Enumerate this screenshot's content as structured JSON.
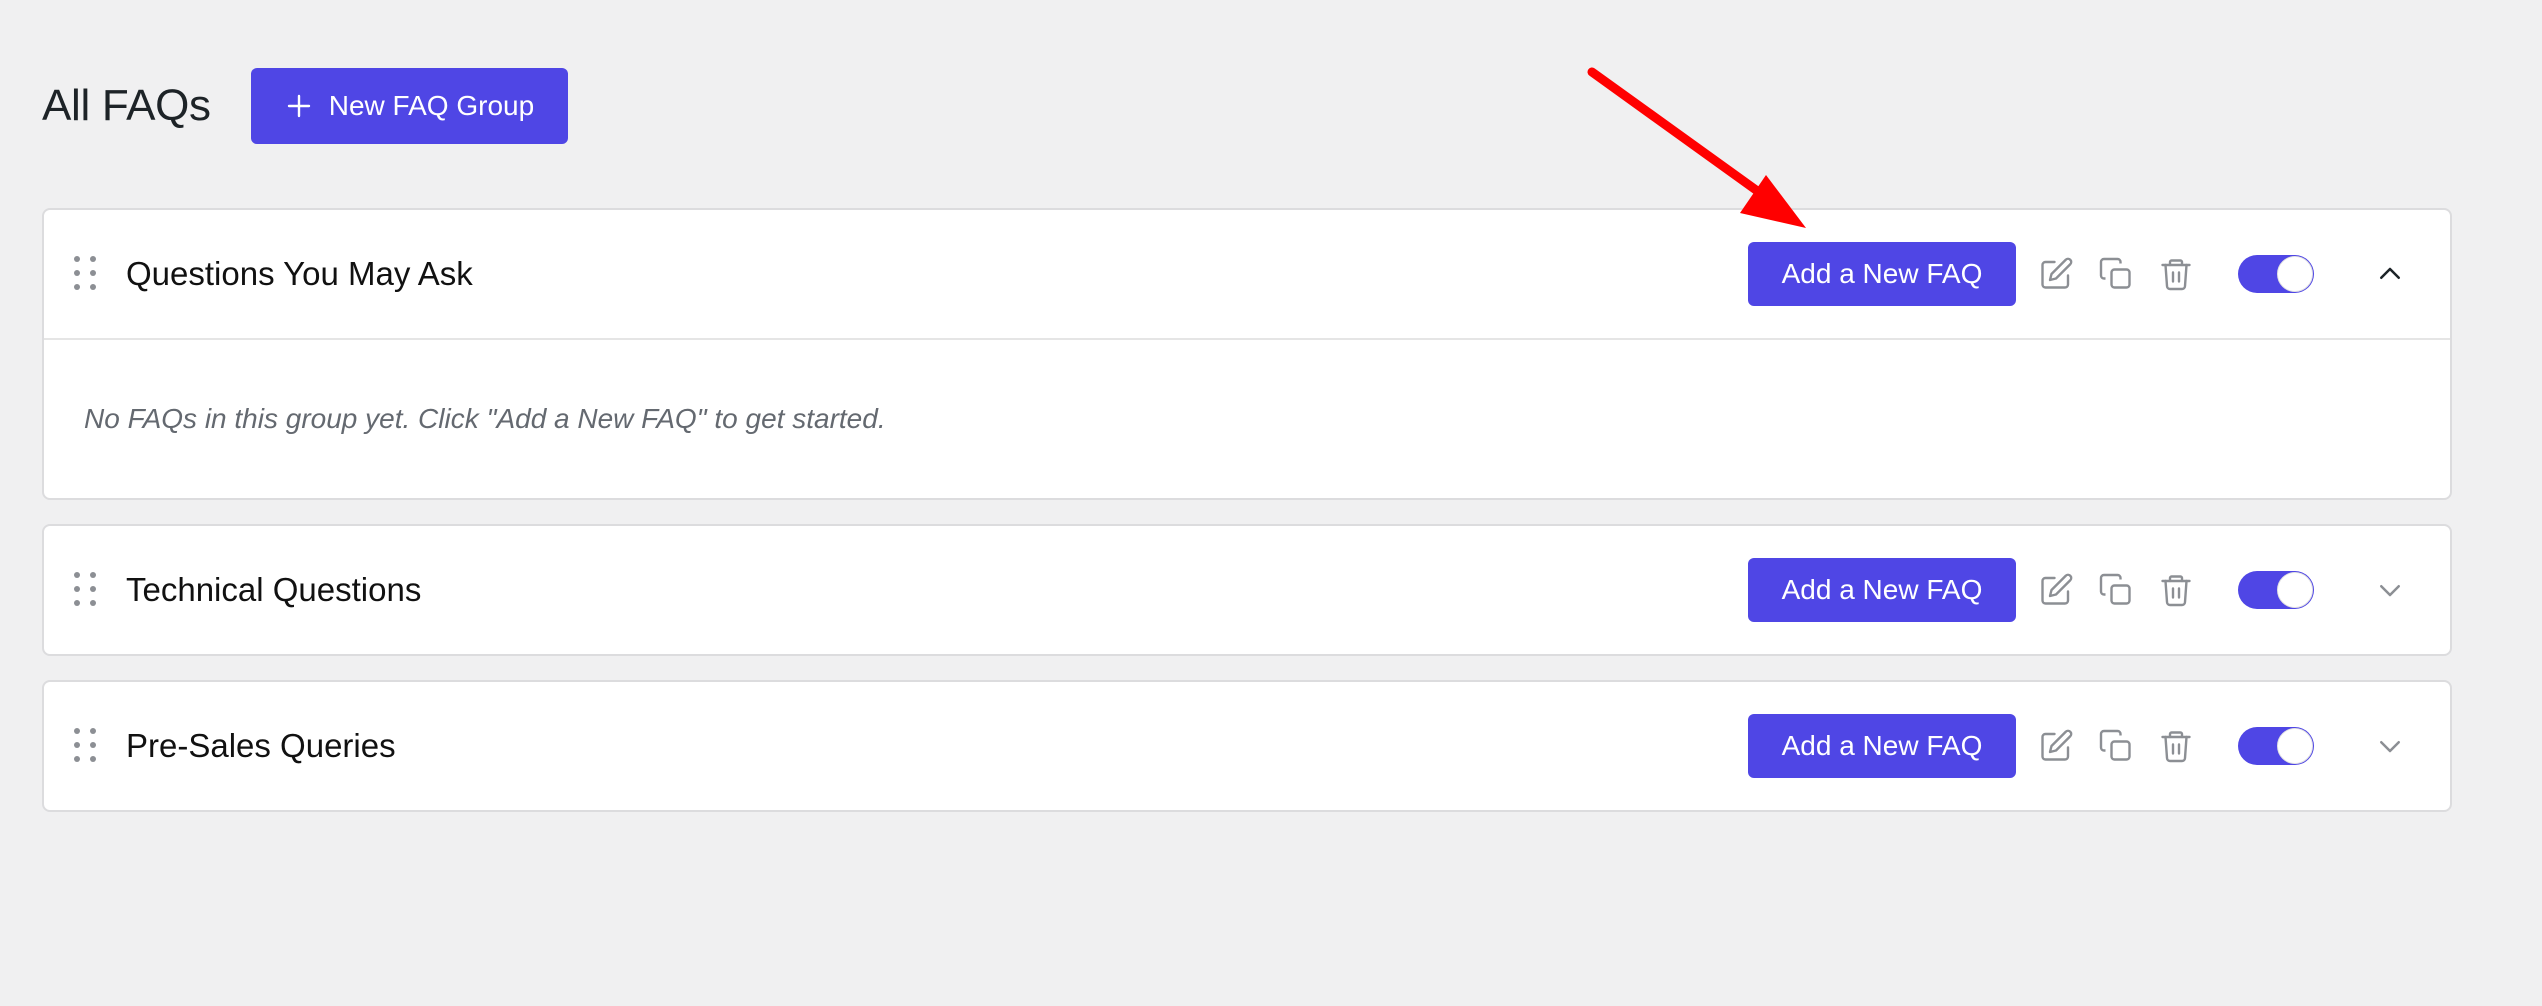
{
  "header": {
    "title": "All FAQs",
    "new_group_label": "New FAQ Group"
  },
  "groups": [
    {
      "title": "Questions You May Ask",
      "add_label": "Add a New FAQ",
      "enabled": true,
      "expanded": true,
      "empty_message": "No FAQs in this group yet. Click \"Add a New FAQ\" to get started."
    },
    {
      "title": "Technical Questions",
      "add_label": "Add a New FAQ",
      "enabled": true,
      "expanded": false
    },
    {
      "title": "Pre-Sales Queries",
      "add_label": "Add a New FAQ",
      "enabled": true,
      "expanded": false
    }
  ],
  "colors": {
    "accent": "#4f46e5",
    "background": "#f0f0f1",
    "icon_gray": "#8c8f94",
    "annotation_arrow": "#ff0000"
  },
  "icons": {
    "drag": "drag-handle-icon",
    "edit": "edit-icon",
    "duplicate": "copy-icon",
    "delete": "trash-icon",
    "collapse": "chevron-up-icon",
    "expand": "chevron-down-icon"
  }
}
